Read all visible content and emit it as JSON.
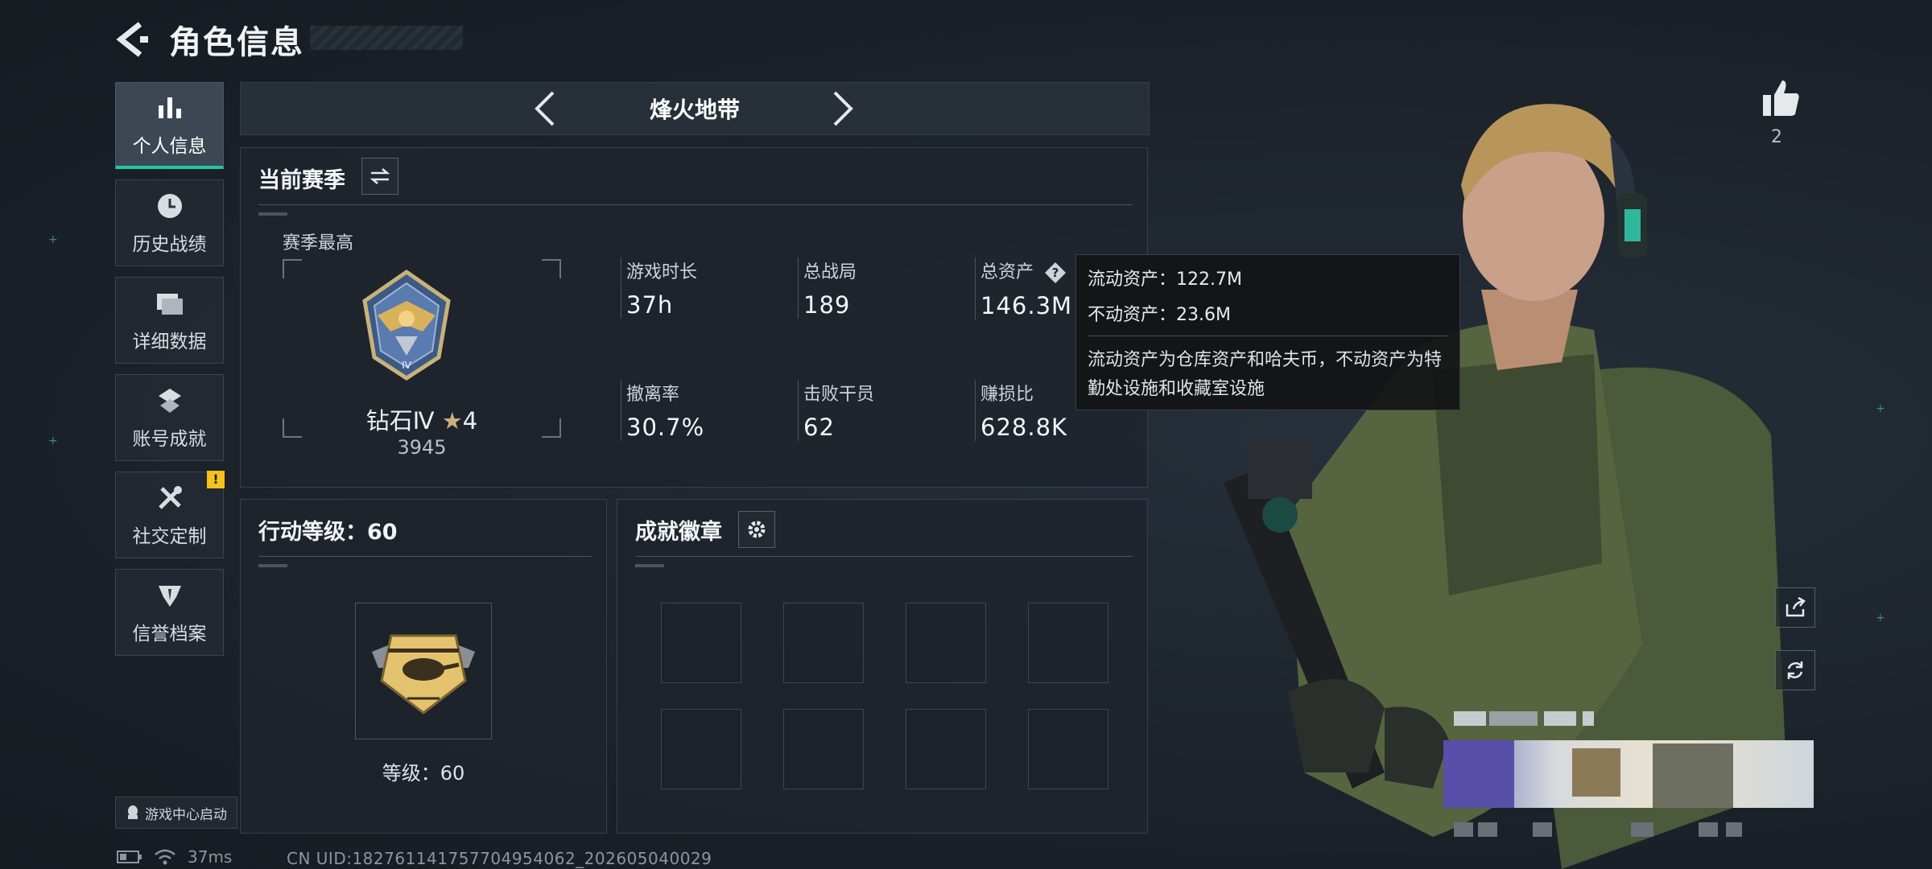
{
  "header": {
    "title": "角色信息"
  },
  "nav": {
    "items": [
      {
        "label": "个人信息",
        "icon": "bar-chart-icon",
        "active": true
      },
      {
        "label": "历史战绩",
        "icon": "history-icon"
      },
      {
        "label": "详细数据",
        "icon": "folder-icon"
      },
      {
        "label": "账号成就",
        "icon": "achievement-icon"
      },
      {
        "label": "社交定制",
        "icon": "tools-icon",
        "badge": "!"
      },
      {
        "label": "信誉档案",
        "icon": "credit-icon"
      }
    ],
    "launch_label": "游戏中心启动"
  },
  "status": {
    "ping": "37ms",
    "uid": "CN UID:18276114175770495406​2_202605040029"
  },
  "mode": {
    "name": "烽火地带"
  },
  "season": {
    "title": "当前赛季",
    "best_label": "赛季最高",
    "rank_name": "钻石Ⅳ",
    "rank_stars": "4",
    "rank_score": "3945",
    "stats": [
      {
        "label": "游戏时长",
        "value": "37h"
      },
      {
        "label": "总战局",
        "value": "189"
      },
      {
        "label": "总资产",
        "value": "146.3M"
      },
      {
        "label": "撤离率",
        "value": "30.7%"
      },
      {
        "label": "击败干员",
        "value": "62"
      },
      {
        "label": "赚损比",
        "value": "628.8K"
      }
    ]
  },
  "tooltip": {
    "liquid": "流动资产：122.7M",
    "fixed": "不动资产：23.6M",
    "desc": "流动资产为仓库资产和哈夫币，不动资产为特勤处设施和收藏室设施"
  },
  "level": {
    "title": "行动等级：60",
    "label": "等级：60"
  },
  "achievements": {
    "title": "成就徽章"
  },
  "social": {
    "like_count": "2"
  },
  "colors": {
    "accent": "#20c7a5",
    "warning": "#f5c11a",
    "background": "#1b222a"
  }
}
